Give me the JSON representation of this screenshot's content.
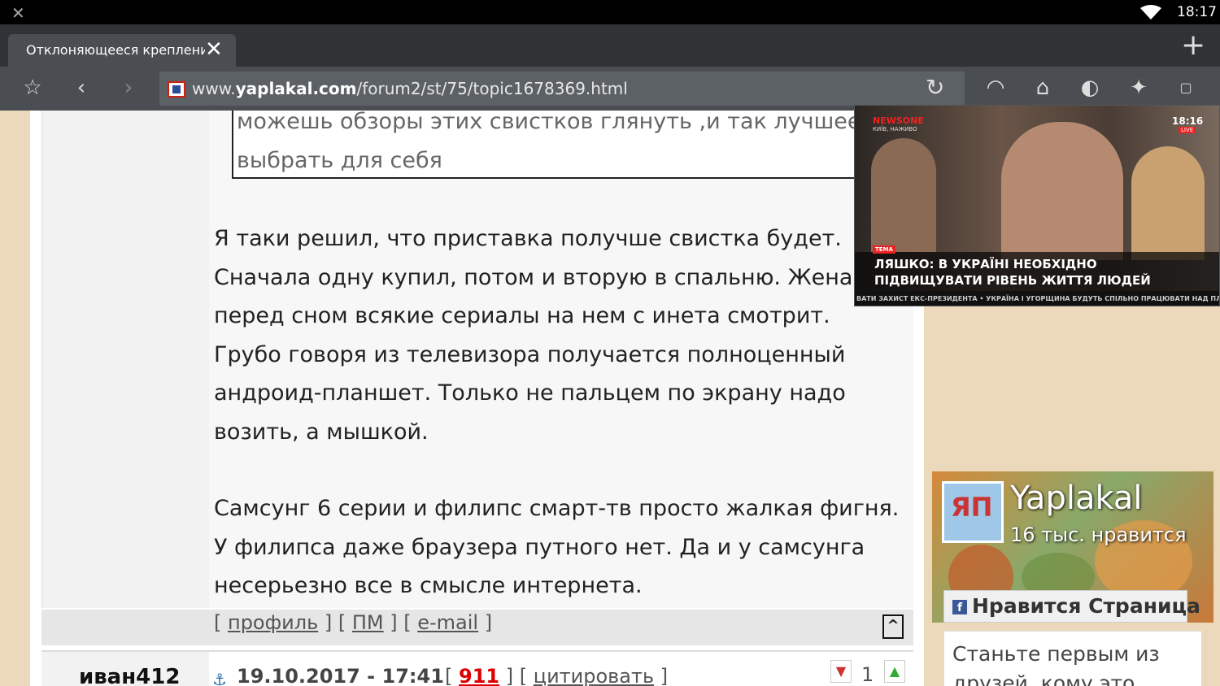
{
  "statusbar": {
    "time": "18:17"
  },
  "tab": {
    "title": "Отклоняющееся креплени…"
  },
  "toolbar": {
    "url_host": "www.",
    "url_domain": "yaplakal.com",
    "url_path": "/forum2/st/75/topic1678369.html"
  },
  "post": {
    "quote_lines": [
      "можешь обзоры этих свистков глянуть ,и так лучшее",
      "выбрать для себя"
    ],
    "paragraph1": [
      "Я таки решил, что приставка получше свистка будет.",
      "Сначала одну купил, потом и вторую в спальню. Жена",
      "перед сном всякие сериалы на нем с инета смотрит.",
      "Грубо говоря из телевизора получается полноценный",
      "андроид-планшет. Только не пальцем по экрану надо",
      "возить, а мышкой."
    ],
    "paragraph2": [
      "Самсунг 6 серии и филипс смарт-тв просто жалкая фигня.",
      "У филипса даже браузера путного нет. Да и у самсунга",
      "несерьезно все в смысле интернета."
    ],
    "footer": {
      "profile": "профиль",
      "pm": "ПМ",
      "email": "e-mail",
      "totop": "^"
    }
  },
  "next_post": {
    "author": "иван412",
    "date": "19.10.2017 - 17:41",
    "number": "911",
    "quote_label": "цитировать",
    "rating": "1"
  },
  "fb_widget": {
    "logo_text": "ЯП",
    "name": "Yaplakal",
    "likes": "16 тыс. нравится",
    "like_button": "Нравится Страница",
    "bottom_text": "Станьте первым из друзей, кому это"
  },
  "video": {
    "channel": "NEWS",
    "channel_accent": "ONE",
    "channel_sub": "КИЇВ, НАЖИВО",
    "time": "18:16",
    "live": "LIVE",
    "tag": "ТЕМА",
    "headline1": "ЛЯШКО: В УКРАЇНІ НЕОБХІДНО",
    "headline2": "ПІДВИЩУВАТИ РІВЕНЬ ЖИТТЯ ЛЮДЕЙ",
    "ticker": "ВАТИ ЗАХИСТ ЕКС-ПРЕЗИДЕНТА • УКРАЇНА І УГОРЩИНА БУДУТЬ СПІЛЬНО ПРАЦЮВАТИ НАД ПЛА"
  },
  "colors": {
    "page_bg": "#ecd9bb",
    "toolbar_bg": "#4a4e52",
    "tabstrip_bg": "#2f3336",
    "accent_red": "#d00000"
  }
}
